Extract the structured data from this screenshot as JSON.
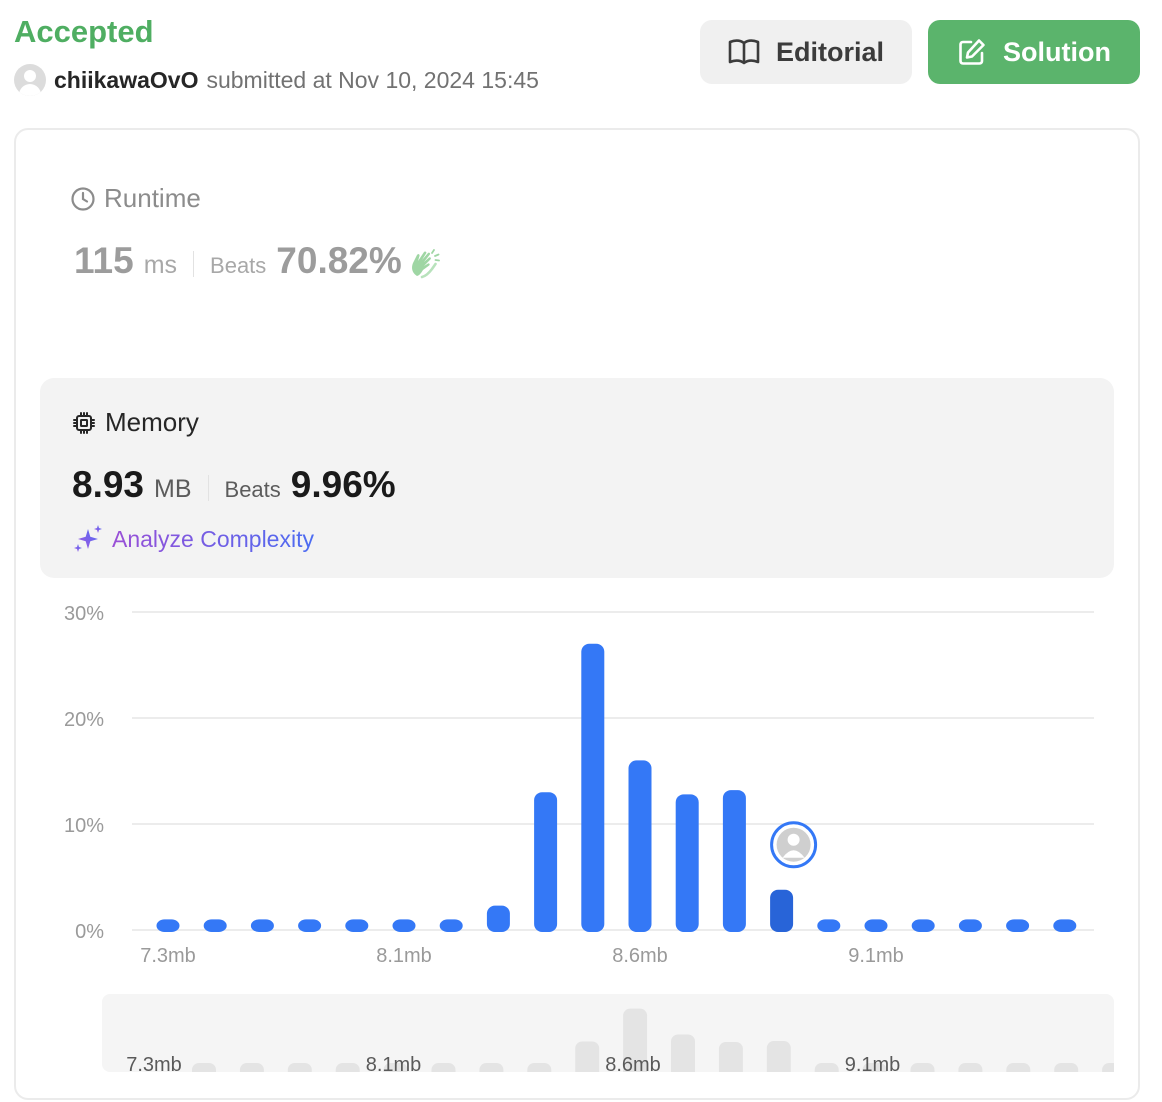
{
  "status": "Accepted",
  "submission": {
    "username": "chiikawaOvO",
    "submitted_text": "submitted at Nov 10, 2024 15:45"
  },
  "buttons": {
    "editorial": "Editorial",
    "solution": "Solution"
  },
  "runtime": {
    "label": "Runtime",
    "value": "115",
    "unit": "ms",
    "beats_label": "Beats",
    "beats_value": "70.82%"
  },
  "memory": {
    "label": "Memory",
    "value": "8.93",
    "unit": "MB",
    "beats_label": "Beats",
    "beats_value": "9.96%"
  },
  "analyze_label": "Analyze Complexity",
  "colors": {
    "accepted": "#4fae62",
    "solution_button": "#5bb46c",
    "bar": "#3478f6",
    "bar_highlight": "#2864d8",
    "nav_bar": "#e4e4e4"
  },
  "chart_data": {
    "type": "bar",
    "title": "",
    "xlabel": "",
    "ylabel": "",
    "ylim": [
      0,
      30
    ],
    "y_ticks": [
      "30%",
      "20%",
      "10%",
      "0%"
    ],
    "y_tick_values": [
      30,
      20,
      10,
      0
    ],
    "x_tick_labels": [
      "7.3mb",
      "8.1mb",
      "8.6mb",
      "9.1mb"
    ],
    "x_tick_indices": [
      0,
      5,
      10,
      15
    ],
    "values": [
      1,
      1,
      1,
      1,
      1,
      1,
      1,
      2.3,
      13,
      27,
      16,
      12.8,
      13.2,
      3.8,
      1,
      1,
      1,
      1,
      1,
      1
    ],
    "user_bar_index": 13,
    "grid": true,
    "navigator": {
      "x_tick_labels": [
        "7.3mb",
        "8.1mb",
        "8.6mb",
        "9.1mb"
      ]
    }
  }
}
